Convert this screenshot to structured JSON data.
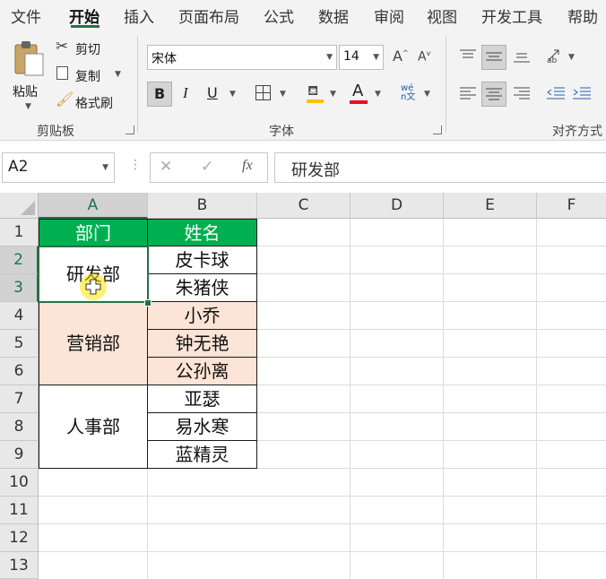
{
  "ribbon_tabs": [
    "文件",
    "开始",
    "插入",
    "页面布局",
    "公式",
    "数据",
    "审阅",
    "视图",
    "开发工具",
    "帮助"
  ],
  "active_tab": "开始",
  "clipboard": {
    "paste": "粘贴",
    "cut": "剪切",
    "copy": "复制",
    "format_painter": "格式刷",
    "group_label": "剪贴板"
  },
  "font": {
    "family": "宋体",
    "size": "14",
    "bold": "B",
    "italic": "I",
    "underline": "U",
    "font_color_glyph": "A",
    "phonetic_glyph": "wén文",
    "group_label": "字体",
    "font_color": "#e81123",
    "fill_color": "#ffc000"
  },
  "alignment": {
    "group_label": "对齐方式"
  },
  "formula_bar": {
    "name_box": "A2",
    "cancel": "✕",
    "enter": "✓",
    "fx": "fx",
    "content": "研发部"
  },
  "columns": [
    "A",
    "B",
    "C",
    "D",
    "E",
    "F"
  ],
  "rows": [
    "1",
    "2",
    "3",
    "4",
    "5",
    "6",
    "7",
    "8",
    "9",
    "10",
    "11",
    "12",
    "13"
  ],
  "table": {
    "header": {
      "dept": "部门",
      "name": "姓名",
      "fill": "#00b050",
      "text_color": "#ffffff"
    },
    "groups": [
      {
        "dept": "研发部",
        "members": [
          "皮卡球",
          "朱猪侠"
        ],
        "fill": "#ffffff"
      },
      {
        "dept": "营销部",
        "members": [
          "小乔",
          "钟无艳",
          "公孙离"
        ],
        "fill": "#fce4d6"
      },
      {
        "dept": "人事部",
        "members": [
          "亚瑟",
          "易水寒",
          "蓝精灵"
        ],
        "fill": "#ffffff"
      }
    ]
  },
  "selected_cell": "A2"
}
